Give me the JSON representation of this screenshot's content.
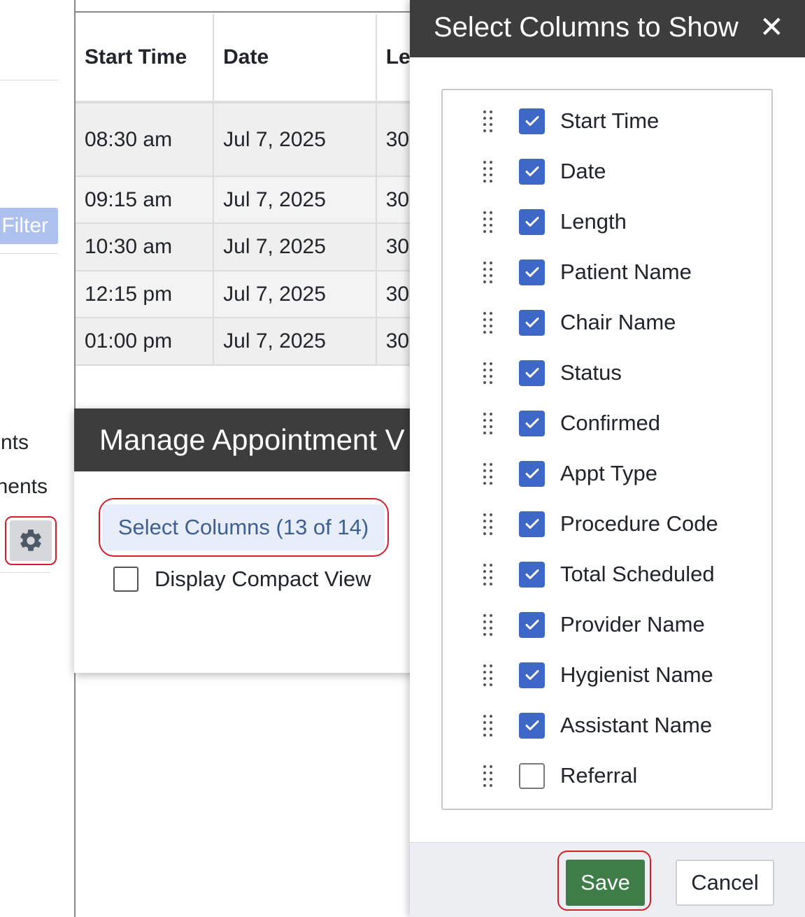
{
  "sidebar": {
    "filter_label": "Filter",
    "link_1": "nts",
    "link_2": "nents"
  },
  "table": {
    "headers": [
      "Start Time",
      "Date",
      "Le"
    ],
    "rows": [
      [
        "08:30 am",
        "Jul 7, 2025",
        "30"
      ],
      [
        "09:15 am",
        "Jul 7, 2025",
        "30"
      ],
      [
        "10:30 am",
        "Jul 7, 2025",
        "30"
      ],
      [
        "12:15 pm",
        "Jul 7, 2025",
        "30"
      ],
      [
        "01:00 pm",
        "Jul 7, 2025",
        "30"
      ]
    ]
  },
  "manage_popover": {
    "title": "Manage Appointment V",
    "select_columns_label": "Select Columns (13 of 14)",
    "compact_view_label": "Display Compact View",
    "compact_view_checked": false
  },
  "columns_panel": {
    "title": "Select Columns to Show",
    "close_glyph": "✕",
    "columns": [
      {
        "label": "Start Time",
        "checked": true
      },
      {
        "label": "Date",
        "checked": true
      },
      {
        "label": "Length",
        "checked": true
      },
      {
        "label": "Patient Name",
        "checked": true
      },
      {
        "label": "Chair Name",
        "checked": true
      },
      {
        "label": "Status",
        "checked": true
      },
      {
        "label": "Confirmed",
        "checked": true
      },
      {
        "label": "Appt Type",
        "checked": true
      },
      {
        "label": "Procedure Code",
        "checked": true
      },
      {
        "label": "Total Scheduled",
        "checked": true
      },
      {
        "label": "Provider Name",
        "checked": true
      },
      {
        "label": "Hygienist Name",
        "checked": true
      },
      {
        "label": "Assistant Name",
        "checked": true
      },
      {
        "label": "Referral",
        "checked": false
      }
    ],
    "save_label": "Save",
    "cancel_label": "Cancel"
  },
  "colors": {
    "header_dark": "#3d3d3d",
    "checkbox_blue": "#3e68c8",
    "save_green": "#3e7d47",
    "highlight_red": "#d21f2b",
    "select_columns_text": "#3d5f93"
  },
  "icons": {
    "gear": "gear-icon",
    "close": "close-icon",
    "drag": "drag-handle-icon",
    "check": "checkmark-icon"
  }
}
